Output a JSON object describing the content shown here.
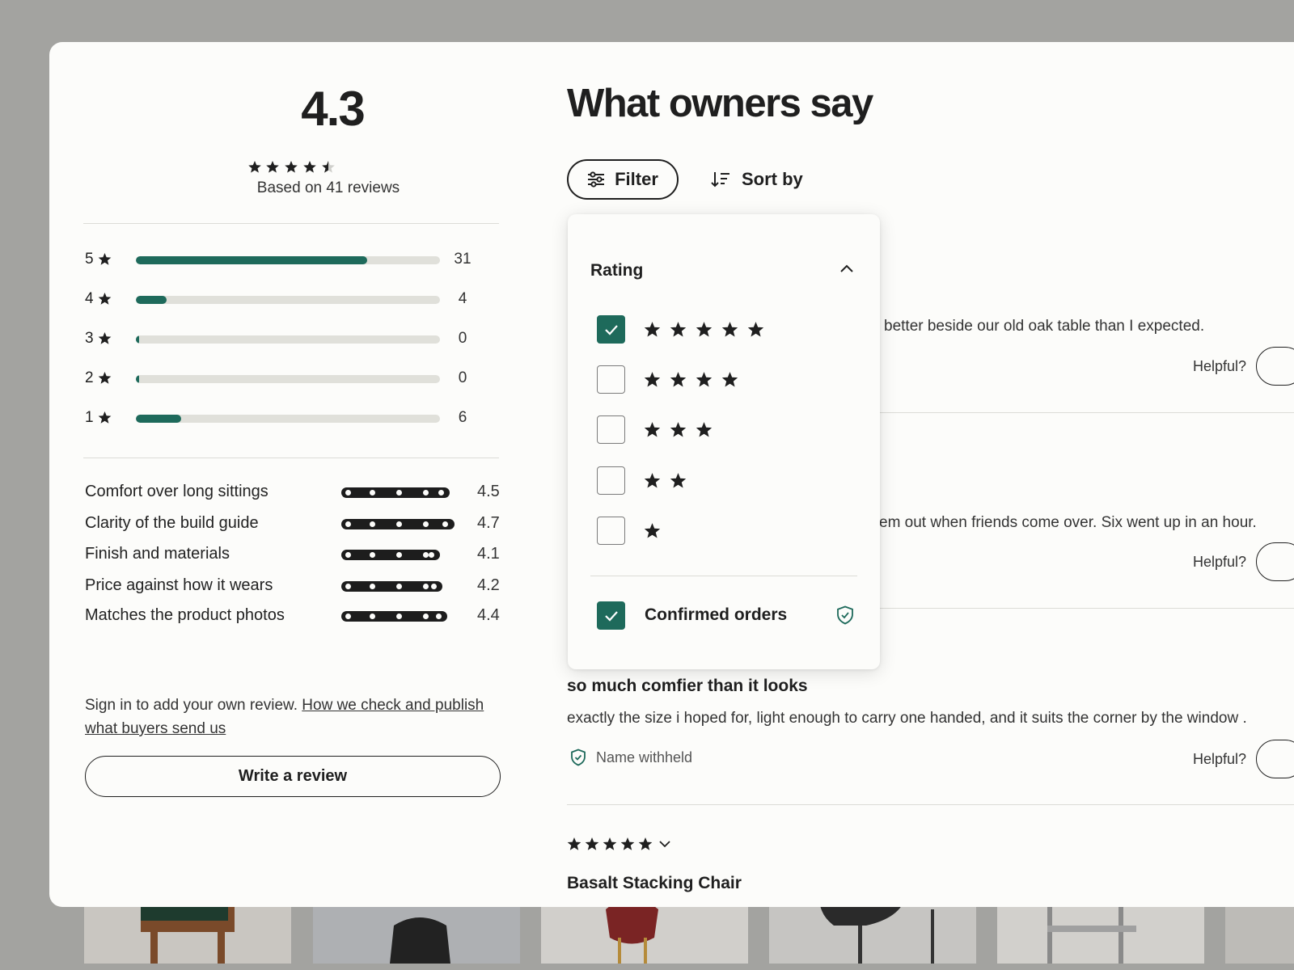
{
  "summary": {
    "average": "4.3",
    "based_on": "Based on 41 reviews",
    "stars_value": 4.3,
    "distribution": [
      {
        "stars": "5",
        "count": "31",
        "fraction": 0.76
      },
      {
        "stars": "4",
        "count": "4",
        "fraction": 0.1
      },
      {
        "stars": "3",
        "count": "0",
        "fraction": 0.0
      },
      {
        "stars": "2",
        "count": "0",
        "fraction": 0.0
      },
      {
        "stars": "1",
        "count": "6",
        "fraction": 0.15
      }
    ],
    "attributes": [
      {
        "name": "Comfort over long sittings",
        "value": "4.5"
      },
      {
        "name": "Clarity of the build guide",
        "value": "4.7"
      },
      {
        "name": "Finish and materials",
        "value": "4.1"
      },
      {
        "name": "Price against how it wears",
        "value": "4.2"
      },
      {
        "name": "Matches the product photos",
        "value": "4.4"
      }
    ],
    "signin_text": "Sign in to add your own review.",
    "signin_link": "How we check and publish what buyers send us",
    "write_review": "Write a review"
  },
  "reviews_header": {
    "title": "What owners say",
    "filter_label": "Filter",
    "sort_label": "Sort by"
  },
  "reviews": [
    {
      "text": "better beside our old oak table than I expected.",
      "helpful": "Helpful?"
    },
    {
      "text": "em out when friends come over. Six went up in an hour.",
      "helpful": "Helpful?"
    },
    {
      "title": "so much comfier than it looks",
      "text": "exactly the size i hoped for, light enough to carry one handed, and it suits the corner by the window .",
      "author": "Name withheld",
      "helpful": "Helpful?"
    },
    {
      "stars": 5,
      "product": "Basalt Stacking Chair"
    }
  ],
  "filter_dropdown": {
    "section_title": "Rating",
    "options": [
      {
        "stars": 5,
        "checked": true
      },
      {
        "stars": 4,
        "checked": false
      },
      {
        "stars": 3,
        "checked": false
      },
      {
        "stars": 2,
        "checked": false
      },
      {
        "stars": 1,
        "checked": false
      }
    ],
    "confirmed_label": "Confirmed orders",
    "confirmed_checked": true
  },
  "colors": {
    "accent": "#1e6a5b",
    "panel": "#fcfcfa",
    "backdrop": "#a3a3a0",
    "text": "#1f1f1f"
  },
  "icons": [
    "star-icon",
    "half-star-icon",
    "filter-sliders-icon",
    "sort-icon",
    "chevron-up-icon",
    "chevron-down-icon",
    "checkmark-icon",
    "shield-check-icon"
  ]
}
